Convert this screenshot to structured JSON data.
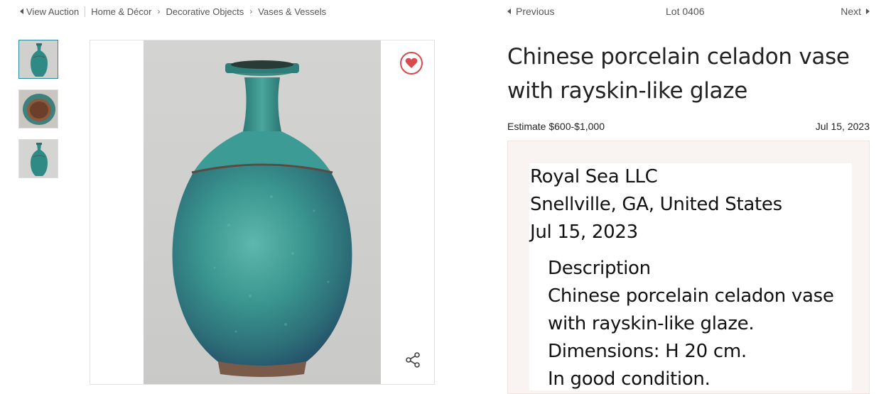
{
  "breadcrumb": {
    "view_auction": "View Auction",
    "items": [
      "Home & Décor",
      "Decorative Objects",
      "Vases & Vessels"
    ]
  },
  "lot_nav": {
    "previous": "Previous",
    "lot_number": "Lot 0406",
    "next": "Next"
  },
  "lot": {
    "title": "Chinese porcelain celadon vase with rayskin-like glaze",
    "estimate": "Estimate $600-$1,000",
    "date": "Jul 15, 2023"
  },
  "description_panel": {
    "seller_name": "Royal Sea LLC",
    "location": "Snellville, GA, United States",
    "date": "Jul 15, 2023",
    "heading": "Description",
    "lines": [
      "Chinese porcelain celadon vase",
      "with rayskin-like glaze.",
      "Dimensions: H 20 cm.",
      "In good condition."
    ]
  },
  "thumbnails": [
    "vase-front",
    "vase-base",
    "vase-front-small"
  ],
  "colors": {
    "accent_teal": "#2a8c9c",
    "favorite_red": "#d94a4a",
    "panel_bg": "#f9f4f2"
  },
  "icons": {
    "favorite": "heart-icon",
    "share": "share-icon",
    "prev": "caret-left-icon",
    "next": "caret-right-icon"
  }
}
